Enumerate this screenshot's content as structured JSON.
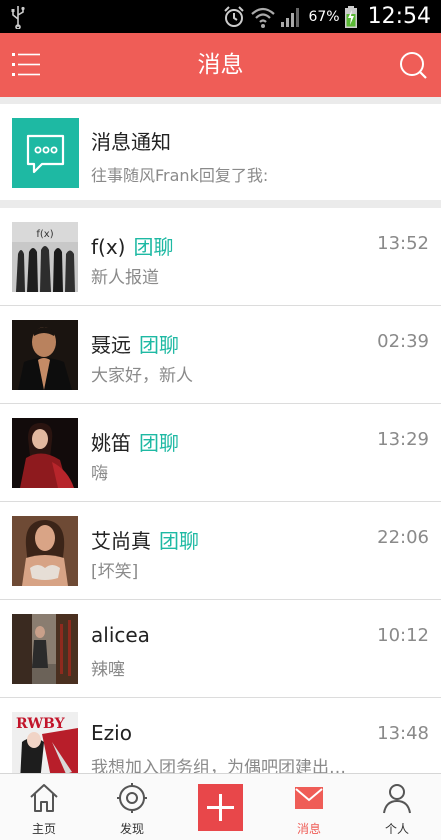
{
  "status_bar": {
    "battery": "67%",
    "time": "12:54",
    "icons": [
      "usb-icon",
      "alarm-icon",
      "wifi-icon",
      "signal-icon",
      "battery-charging-icon"
    ]
  },
  "header": {
    "title": "消息",
    "menu_icon": "menu-icon",
    "search_icon": "search-icon",
    "color": "#ef5d57"
  },
  "notification": {
    "title": "消息通知",
    "subtitle": "往事随风Frank回复了我:",
    "icon": "chat-bubble-icon",
    "icon_color": "#1eb9a3"
  },
  "chats": [
    {
      "name": "f(x)",
      "tag": "团聊",
      "time": "13:52",
      "message": "新人报道",
      "avatar_logo": "f(x)"
    },
    {
      "name": "聂远",
      "tag": "团聊",
      "time": "02:39",
      "message": "大家好，新人"
    },
    {
      "name": "姚笛",
      "tag": "团聊",
      "time": "13:29",
      "message": "嗨"
    },
    {
      "name": "艾尚真",
      "tag": "团聊",
      "time": "22:06",
      "message": "[坏笑]"
    },
    {
      "name": "alicea",
      "tag": "",
      "time": "10:12",
      "message": "辣噻"
    },
    {
      "name": "Ezio",
      "tag": "",
      "time": "13:48",
      "message": "我想加入团务组，为偶吧团建出…",
      "avatar_logo": "RWBY"
    }
  ],
  "bottom_nav": {
    "items": [
      {
        "label": "主页",
        "icon": "home-icon"
      },
      {
        "label": "发现",
        "icon": "discover-icon"
      },
      {
        "label": "",
        "icon": "add-icon"
      },
      {
        "label": "消息",
        "icon": "mail-icon",
        "active": true
      },
      {
        "label": "个人",
        "icon": "person-icon"
      }
    ],
    "accent": "#ef5d57"
  }
}
